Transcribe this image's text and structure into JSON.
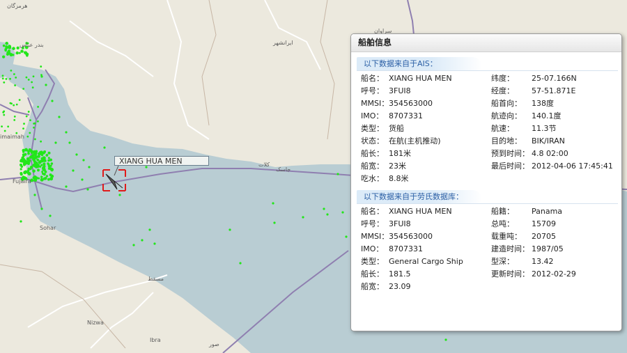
{
  "map": {
    "places": {
      "sohar": "Sohar",
      "fujairah": "Fujaira",
      "ras_al_khaimah": "imaimah",
      "muscat": "مسقط",
      "nizwa": "Nizwa",
      "ibra": "Ibra",
      "saravan": "سراوان",
      "iranshahr": "ایرانشهر",
      "jask": "جاسک",
      "kalat": "کلات",
      "bandar_abbas": "بندر عباس",
      "sur": "صور",
      "hormozgan": "هرمزگان"
    },
    "colors": {
      "sea": "#b9cdd3",
      "land": "#ece9de",
      "border": "#8f7fb0",
      "ship_dot": "#22e61a",
      "road": "#ffffff"
    }
  },
  "ship_label": "XIANG HUA MEN",
  "panel": {
    "title": "船舶信息",
    "ais_section_title": "以下数据来自于AIS：",
    "ais_left": [
      {
        "key": "船名：",
        "value": "XIANG HUA MEN"
      },
      {
        "key": "呼号：",
        "value": "3FUI8"
      },
      {
        "key": "MMSI：",
        "value": "354563000"
      },
      {
        "key": "IMO：",
        "value": "8707331"
      },
      {
        "key": "类型：",
        "value": "货船"
      },
      {
        "key": "状态：",
        "value": "在航(主机推动)"
      },
      {
        "key": "船长：",
        "value": "181米"
      },
      {
        "key": "船宽：",
        "value": "23米"
      },
      {
        "key": "吃水：",
        "value": "8.8米"
      }
    ],
    "ais_right": [
      {
        "key": "纬度：",
        "value": "25-07.166N"
      },
      {
        "key": "经度：",
        "value": "57-51.871E"
      },
      {
        "key": "船首向：",
        "value": "138度"
      },
      {
        "key": "航迹向：",
        "value": "140.1度"
      },
      {
        "key": "航速：",
        "value": "11.3节"
      },
      {
        "key": "目的地：",
        "value": "BIK/IRAN"
      },
      {
        "key": "预到时间：",
        "value": "4.8 02:00"
      },
      {
        "key": "最后时间：",
        "value": "2012-04-06 17:45:41"
      }
    ],
    "lloyds_section_title": "以下数据来自于劳氏数据库：",
    "lloyds_left": [
      {
        "key": "船名：",
        "value": "XIANG HUA MEN"
      },
      {
        "key": "呼号：",
        "value": "3FUI8"
      },
      {
        "key": "MMSI：",
        "value": "354563000"
      },
      {
        "key": "IMO：",
        "value": "8707331"
      },
      {
        "key": "类型：",
        "value": "General Cargo Ship"
      },
      {
        "key": "船长：",
        "value": "181.5"
      },
      {
        "key": "船宽：",
        "value": "23.09"
      }
    ],
    "lloyds_right": [
      {
        "key": "船籍：",
        "value": "Panama"
      },
      {
        "key": "总吨：",
        "value": "15709"
      },
      {
        "key": "载重吨：",
        "value": "20705"
      },
      {
        "key": "建造时间：",
        "value": "1987/05"
      },
      {
        "key": "型深：",
        "value": "13.42"
      },
      {
        "key": "更新时间：",
        "value": "2012-02-29"
      }
    ]
  }
}
